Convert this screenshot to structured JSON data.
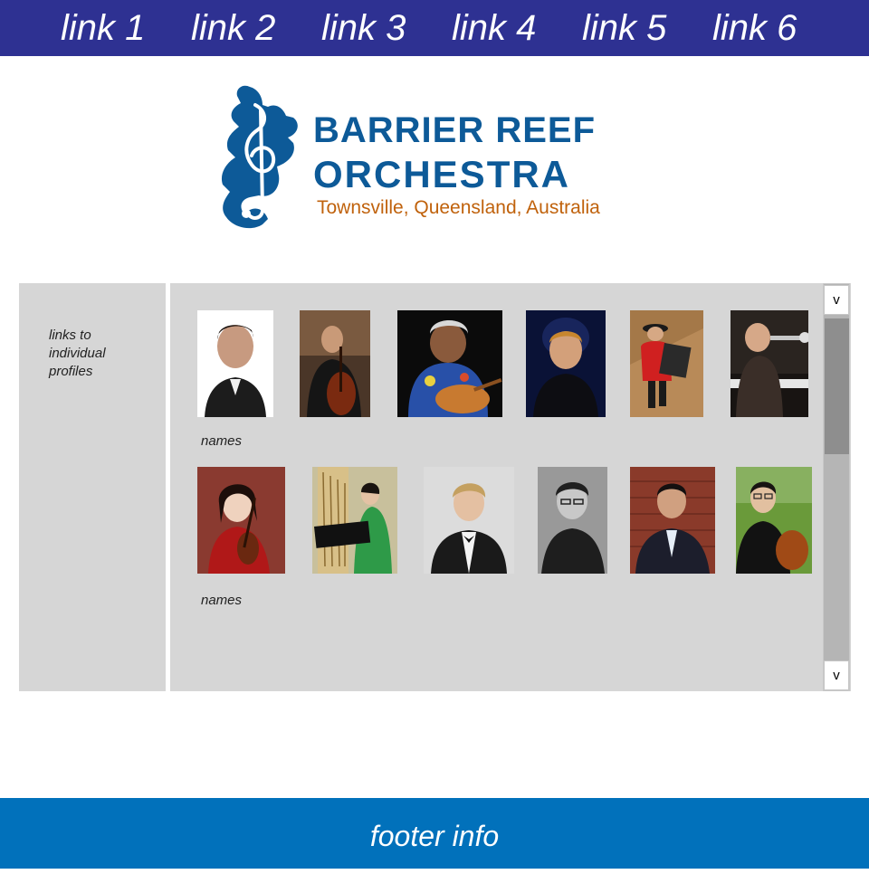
{
  "nav": {
    "links": [
      "link 1",
      "link 2",
      "link 3",
      "link 4",
      "link 5",
      "link 6"
    ],
    "background": "#2e3192"
  },
  "logo": {
    "line1": "BARRIER REEF",
    "line2": "ORCHESTRA",
    "tagline": "Townsville, Queensland, Australia",
    "icon": "treble-clef-seahorse-icon",
    "primary_color": "#0d5a98",
    "tagline_color": "#c0620c"
  },
  "sidebar": {
    "text": "links to individual profiles"
  },
  "gallery": {
    "rows": [
      {
        "names_label": "names"
      },
      {
        "names_label": "names"
      }
    ]
  },
  "scrollbar": {
    "up_label": "v",
    "down_label": "v"
  },
  "footer": {
    "text": "footer info",
    "background": "#0171bb"
  }
}
